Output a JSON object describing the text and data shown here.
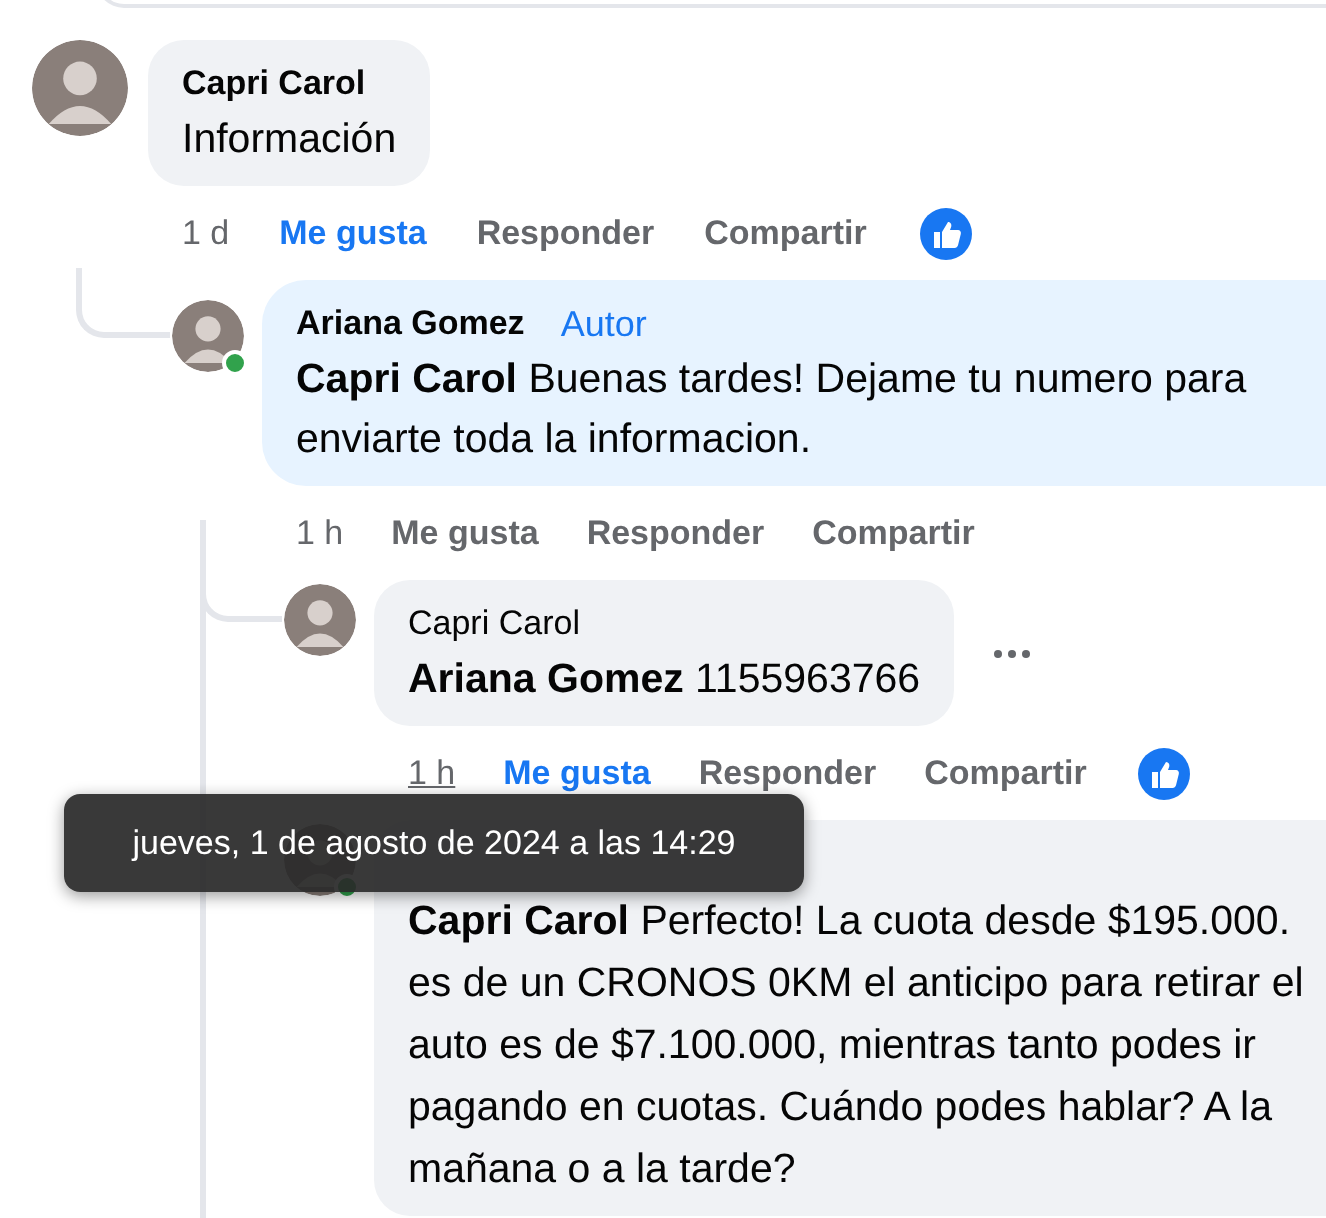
{
  "comments": [
    {
      "author": "Capri Carol",
      "name_bold": true,
      "text": "Información",
      "online": false,
      "time": "1 d",
      "time_hovered": false,
      "liked": true,
      "reacted": true,
      "more_menu": false,
      "actions": [
        "Me gusta",
        "Responder",
        "Compartir"
      ],
      "children": [
        {
          "author": "Ariana Gomez",
          "name_bold": true,
          "badge": "Autor",
          "text": "**Capri Carol** Buenas tardes! Dejame tu numero para enviarte toda la informacion.",
          "online": true,
          "time": "1 h",
          "time_hovered": false,
          "liked": false,
          "reacted": false,
          "more_menu": false,
          "actions": [
            "Me gusta",
            "Responder",
            "Compartir"
          ],
          "children": [
            {
              "author": "Capri Carol",
              "name_bold": false,
              "text": "**Ariana Gomez** 1155963766",
              "online": false,
              "time": "1 h",
              "time_hovered": true,
              "liked": true,
              "reacted": true,
              "more_menu": true,
              "actions": [
                "Me gusta",
                "Responder",
                "Compartir"
              ]
            },
            {
              "text": "**Capri Carol** Perfecto! La cuota desde $195.000. es de un CRONOS 0KM el anticipo para retirar el auto es de $7.100.000, mientras tanto podes ir pagando en cuotas. Cuándo podes hablar? A la mañana o a la tarde?",
              "online": true,
              "more_menu": false
            }
          ]
        }
      ]
    }
  ],
  "tooltip": {
    "text": "jueves, 1 de agosto de 2024 a las 14:29"
  }
}
